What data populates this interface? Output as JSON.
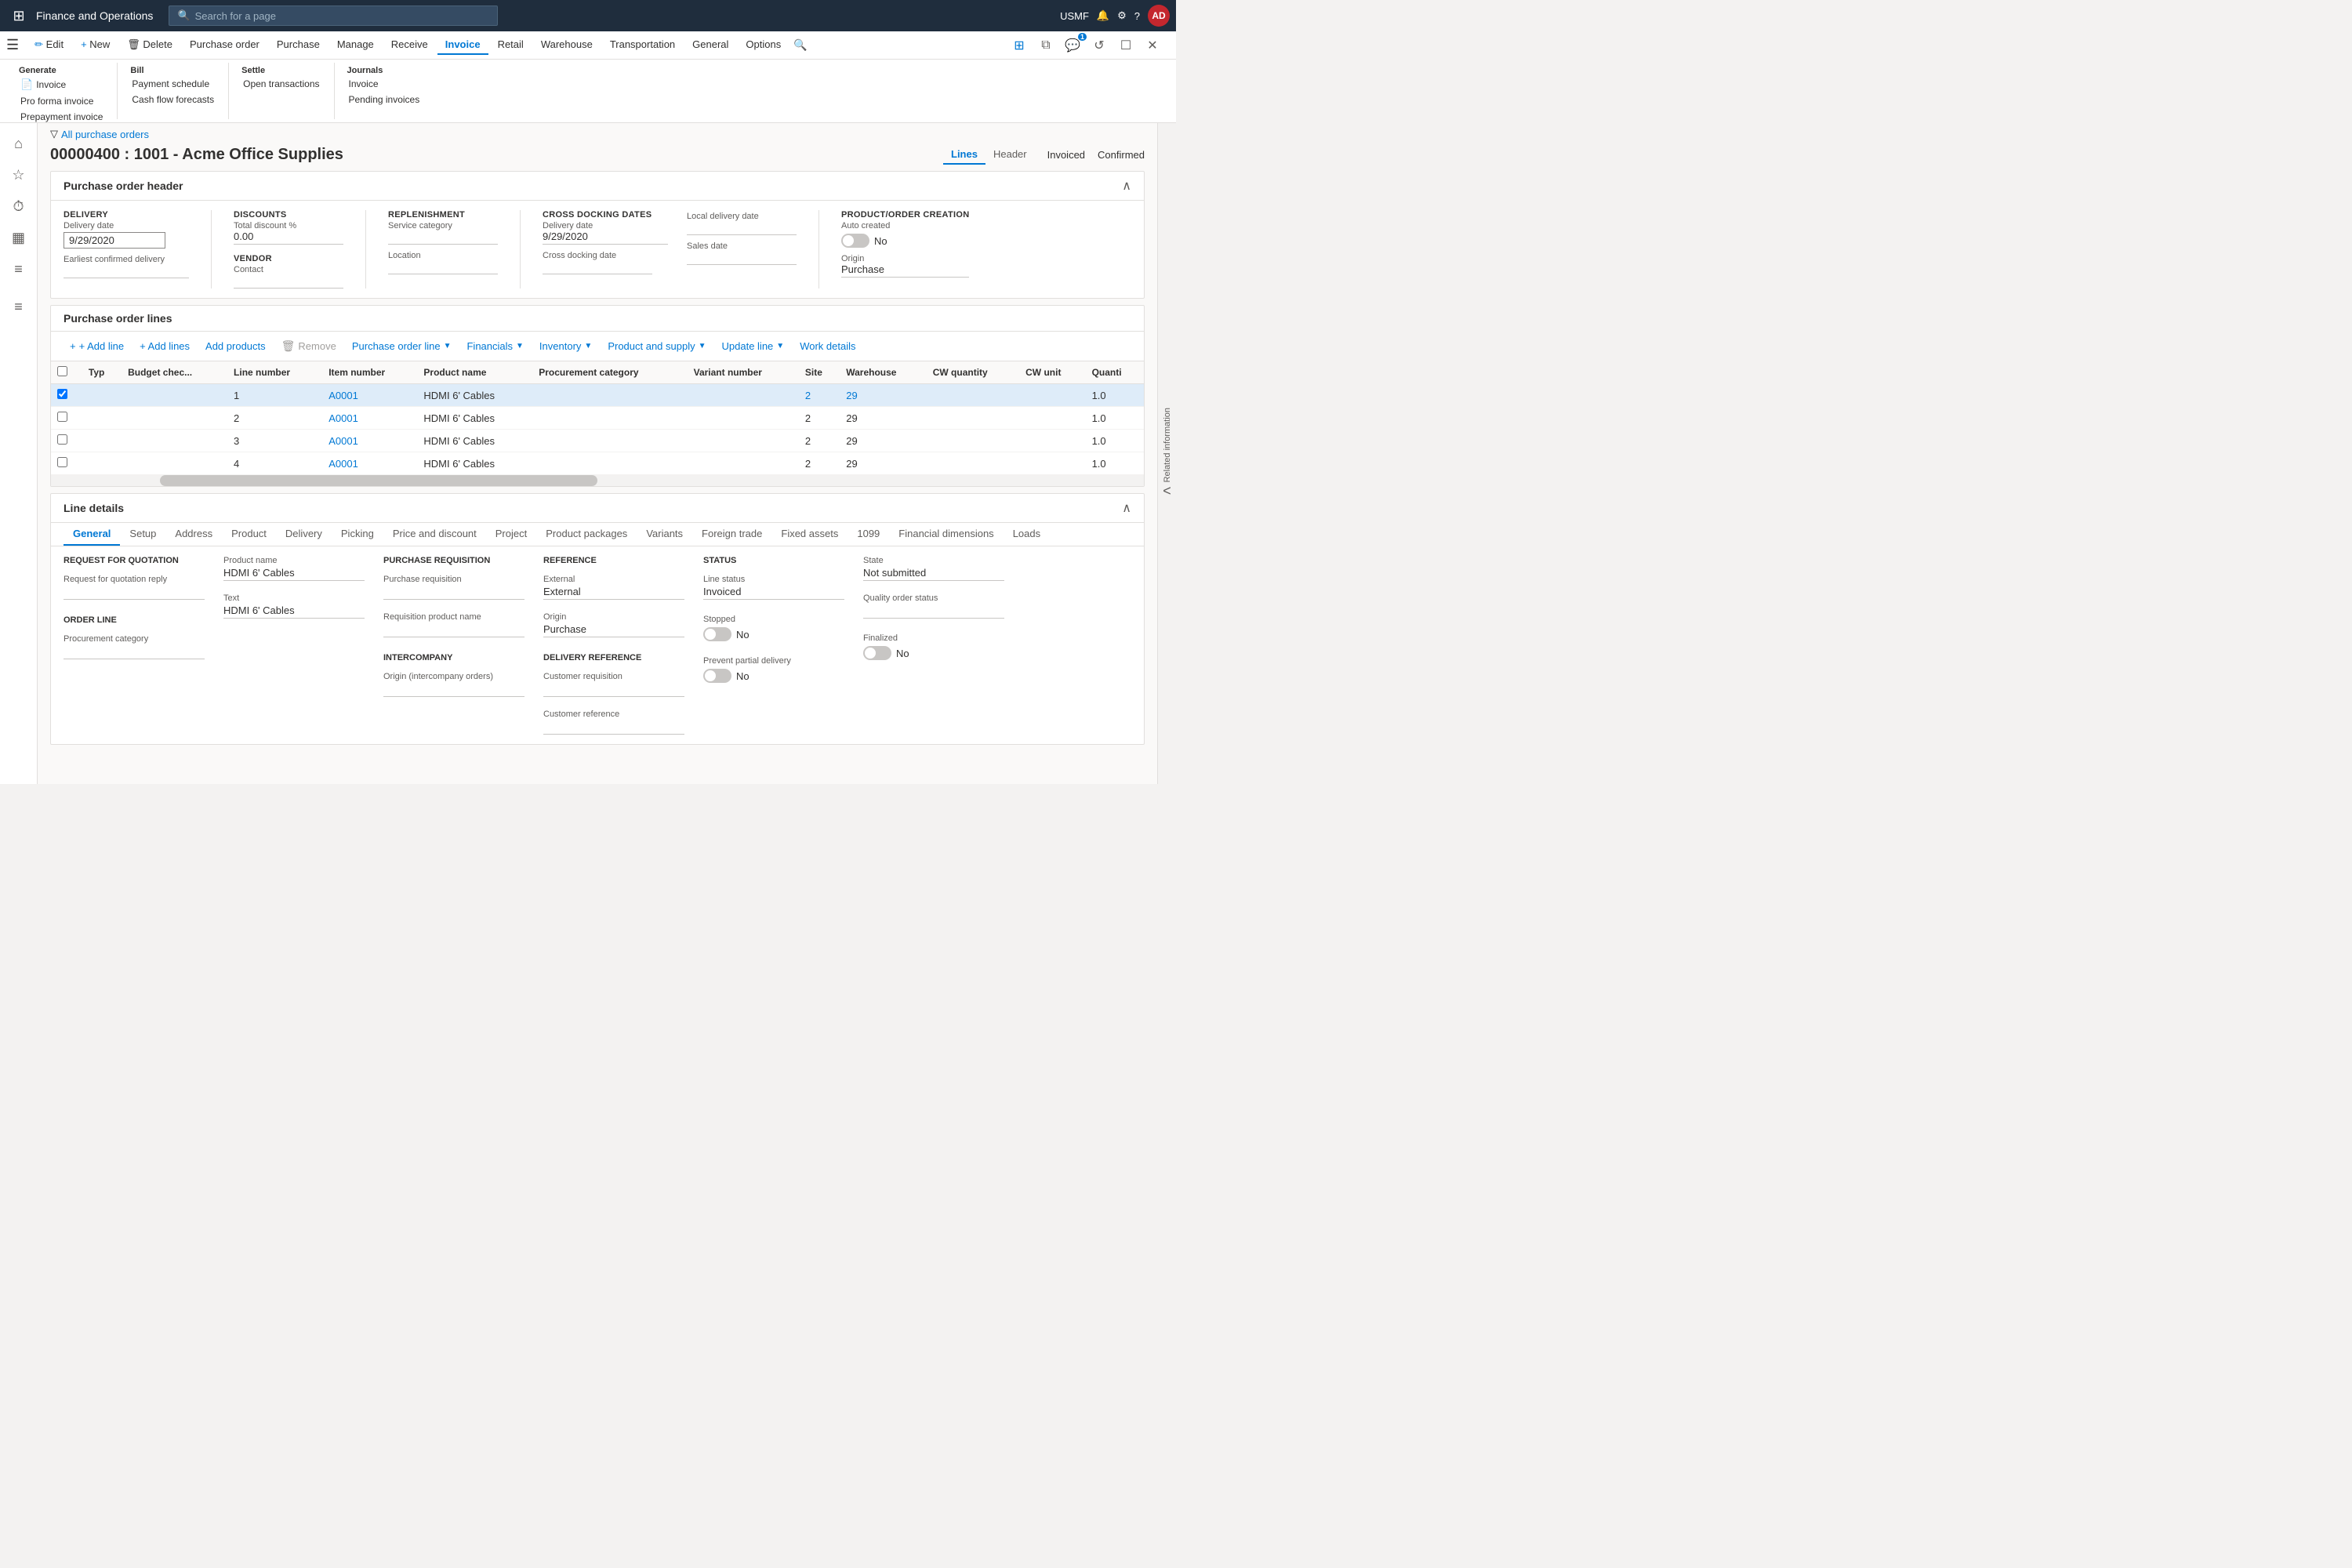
{
  "app": {
    "title": "Finance and Operations",
    "user": "USMF",
    "avatar": "AD"
  },
  "search": {
    "placeholder": "Search for a page"
  },
  "ribbon": {
    "edit_label": "Edit",
    "new_label": "New",
    "delete_label": "Delete",
    "tabs": [
      "Purchase order",
      "Purchase",
      "Manage",
      "Receive",
      "Invoice",
      "Retail",
      "Warehouse",
      "Transportation",
      "General",
      "Options"
    ],
    "active_tab": "Invoice",
    "generate_group": "Generate",
    "generate_items": [
      "Invoice",
      "Pro forma invoice",
      "Prepayment invoice"
    ],
    "bill_group": "Bill",
    "bill_items": [
      "Payment schedule",
      "Cash flow forecasts"
    ],
    "settle_group": "Settle",
    "settle_items": [
      "Open transactions"
    ],
    "journals_group": "Journals",
    "journals_items": [
      "Invoice",
      "Pending invoices"
    ]
  },
  "breadcrumb": {
    "filter_icon": "▽",
    "link_text": "All purchase orders"
  },
  "page": {
    "title": "00000400 : 1001 - Acme Office Supplies",
    "status": "Invoiced",
    "confirmed": "Confirmed",
    "tabs": [
      "Lines",
      "Header"
    ],
    "active_tab": "Lines"
  },
  "purchase_order_header": {
    "title": "Purchase order header",
    "delivery": {
      "label": "DELIVERY",
      "date_label": "Delivery date",
      "date_value": "9/29/2020",
      "earliest_label": "Earliest confirmed delivery"
    },
    "discounts": {
      "label": "DISCOUNTS",
      "total_label": "Total discount %",
      "total_value": "0.00"
    },
    "vendor": {
      "label": "VENDOR",
      "contact_label": "Contact"
    },
    "replenishment": {
      "label": "REPLENISHMENT",
      "service_label": "Service category",
      "location_label": "Location"
    },
    "cross_docking": {
      "label": "CROSS DOCKING DATES",
      "date_label": "Delivery date",
      "date_value": "9/29/2020",
      "cross_label": "Cross docking date",
      "local_label": "Local delivery date",
      "sales_label": "Sales date"
    },
    "product_order": {
      "label": "PRODUCT/ORDER CREATION",
      "auto_label": "Auto created",
      "auto_value": "No",
      "origin_label": "Origin",
      "origin_value": "Purchase"
    }
  },
  "purchase_order_lines": {
    "title": "Purchase order lines",
    "toolbar": {
      "add_line": "+ Add line",
      "add_lines": "+ Add lines",
      "add_products": "Add products",
      "remove": "Remove",
      "purchase_order_line": "Purchase order line",
      "financials": "Financials",
      "inventory": "Inventory",
      "product_and_supply": "Product and supply",
      "update_line": "Update line",
      "work_details": "Work details"
    },
    "columns": [
      "",
      "Typ",
      "Budget chec...",
      "Line number",
      "Item number",
      "Product name",
      "Procurement category",
      "Variant number",
      "Site",
      "Warehouse",
      "CW quantity",
      "CW unit",
      "Quanti"
    ],
    "rows": [
      {
        "typ": "",
        "budget": "",
        "line": "1",
        "item": "A0001",
        "product": "HDMI 6' Cables",
        "procurement": "",
        "variant": "",
        "site": "2",
        "warehouse": "29",
        "cw_qty": "",
        "cw_unit": "",
        "qty": "1.0",
        "selected": true
      },
      {
        "typ": "",
        "budget": "",
        "line": "2",
        "item": "A0001",
        "product": "HDMI 6' Cables",
        "procurement": "",
        "variant": "",
        "site": "2",
        "warehouse": "29",
        "cw_qty": "",
        "cw_unit": "",
        "qty": "1.0",
        "selected": false
      },
      {
        "typ": "",
        "budget": "",
        "line": "3",
        "item": "A0001",
        "product": "HDMI 6' Cables",
        "procurement": "",
        "variant": "",
        "site": "2",
        "warehouse": "29",
        "cw_qty": "",
        "cw_unit": "",
        "qty": "1.0",
        "selected": false
      },
      {
        "typ": "",
        "budget": "",
        "line": "4",
        "item": "A0001",
        "product": "HDMI 6' Cables",
        "procurement": "",
        "variant": "",
        "site": "2",
        "warehouse": "29",
        "cw_qty": "",
        "cw_unit": "",
        "qty": "1.0",
        "selected": false
      }
    ]
  },
  "line_details": {
    "title": "Line details",
    "tabs": [
      "General",
      "Setup",
      "Address",
      "Product",
      "Delivery",
      "Picking",
      "Price and discount",
      "Project",
      "Product packages",
      "Variants",
      "Foreign trade",
      "Fixed assets",
      "1099",
      "Financial dimensions",
      "Loads"
    ],
    "active_tab": "General",
    "rfq": {
      "title": "REQUEST FOR QUOTATION",
      "reply_label": "Request for quotation reply"
    },
    "order_line": {
      "title": "ORDER LINE",
      "procurement_label": "Procurement category"
    },
    "product_name": {
      "label": "Product name",
      "value": "HDMI 6' Cables",
      "text_label": "Text",
      "text_value": "HDMI 6' Cables"
    },
    "purchase_req": {
      "title": "PURCHASE REQUISITION",
      "req_label": "Purchase requisition",
      "req_name_label": "Requisition product name"
    },
    "intercompany": {
      "title": "INTERCOMPANY",
      "origin_label": "Origin (intercompany orders)"
    },
    "reference": {
      "title": "REFERENCE",
      "external_label": "External",
      "external_value": "External",
      "origin_label": "Origin",
      "origin_value": "Purchase"
    },
    "delivery_ref": {
      "title": "DELIVERY REFERENCE",
      "cust_req_label": "Customer requisition",
      "cust_ref_label": "Customer reference"
    },
    "status": {
      "title": "STATUS",
      "line_status_label": "Line status",
      "line_status_value": "Invoiced",
      "stopped_label": "Stopped",
      "stopped_value": "No",
      "prevent_label": "Prevent partial delivery",
      "prevent_value": "No"
    },
    "state": {
      "state_label": "State",
      "state_value": "Not submitted",
      "quality_label": "Quality order status",
      "finalized_label": "Finalized",
      "finalized_value": "No"
    }
  },
  "right_panel": {
    "label": "Related information"
  }
}
